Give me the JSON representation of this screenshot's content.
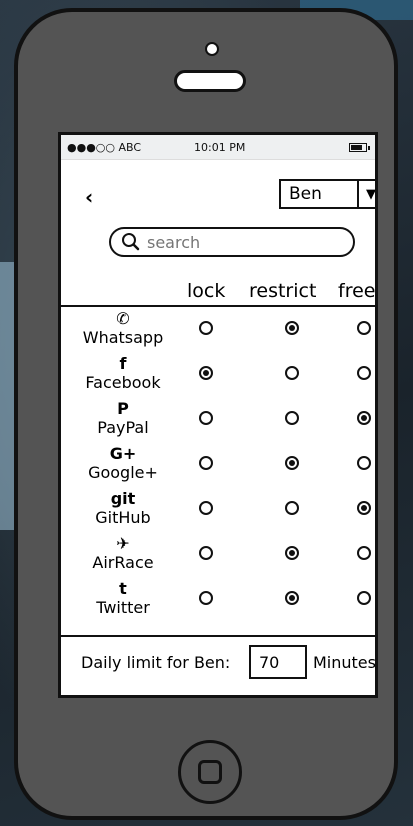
{
  "status_bar": {
    "carrier": "●●●○○ ABC",
    "time": "10:01 PM"
  },
  "header": {
    "back_label": "‹",
    "user_selected": "Ben",
    "dropdown_glyph": "▼"
  },
  "search": {
    "placeholder": "search"
  },
  "columns": {
    "lock": "lock",
    "restrict": "restrict",
    "free": "free"
  },
  "apps": [
    {
      "name": "Whatsapp",
      "icon": "whatsapp-icon",
      "glyph": "✆",
      "selected": "restrict"
    },
    {
      "name": "Facebook",
      "icon": "facebook-icon",
      "glyph": "f",
      "selected": "lock"
    },
    {
      "name": "PayPal",
      "icon": "paypal-icon",
      "glyph": "P",
      "selected": "free"
    },
    {
      "name": "Google+",
      "icon": "google-plus-icon",
      "glyph": "G+",
      "selected": "restrict"
    },
    {
      "name": "GitHub",
      "icon": "github-icon",
      "glyph": "git",
      "selected": "free"
    },
    {
      "name": "AirRace",
      "icon": "airplane-icon",
      "glyph": "✈",
      "selected": "restrict"
    },
    {
      "name": "Twitter",
      "icon": "twitter-icon",
      "glyph": "t",
      "selected": "restrict"
    }
  ],
  "footer": {
    "label": "Daily limit for Ben:",
    "value": "70",
    "unit": "Minutes"
  }
}
